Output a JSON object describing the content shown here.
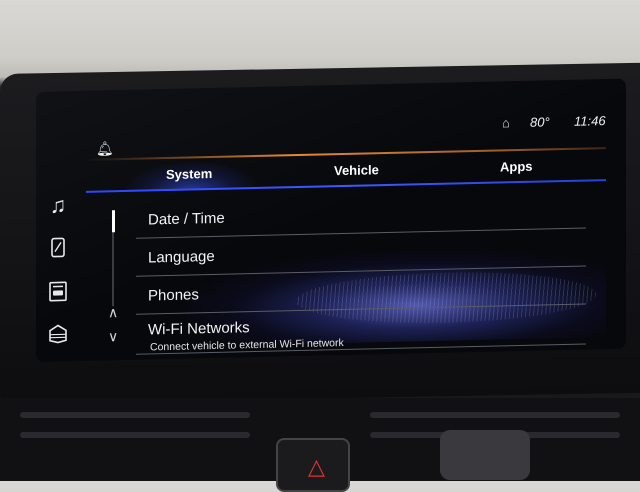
{
  "status_bar": {
    "temperature": "80°",
    "time": "11:46"
  },
  "tabs": [
    {
      "label": "System",
      "active": true
    },
    {
      "label": "Vehicle",
      "active": false
    },
    {
      "label": "Apps",
      "active": false
    }
  ],
  "menu": [
    {
      "label": "Date / Time"
    },
    {
      "label": "Language"
    },
    {
      "label": "Phones"
    },
    {
      "label": "Wi-Fi Networks",
      "sublabel": "Connect vehicle to external Wi-Fi network"
    }
  ],
  "sidebar_icons": [
    "music-note-icon",
    "phone-icon",
    "vehicle-info-icon",
    "apps-icon"
  ],
  "colors": {
    "accent_blue": "#2c47ff",
    "accent_orange": "#ff9a3c",
    "hazard_red": "#e0362b"
  }
}
